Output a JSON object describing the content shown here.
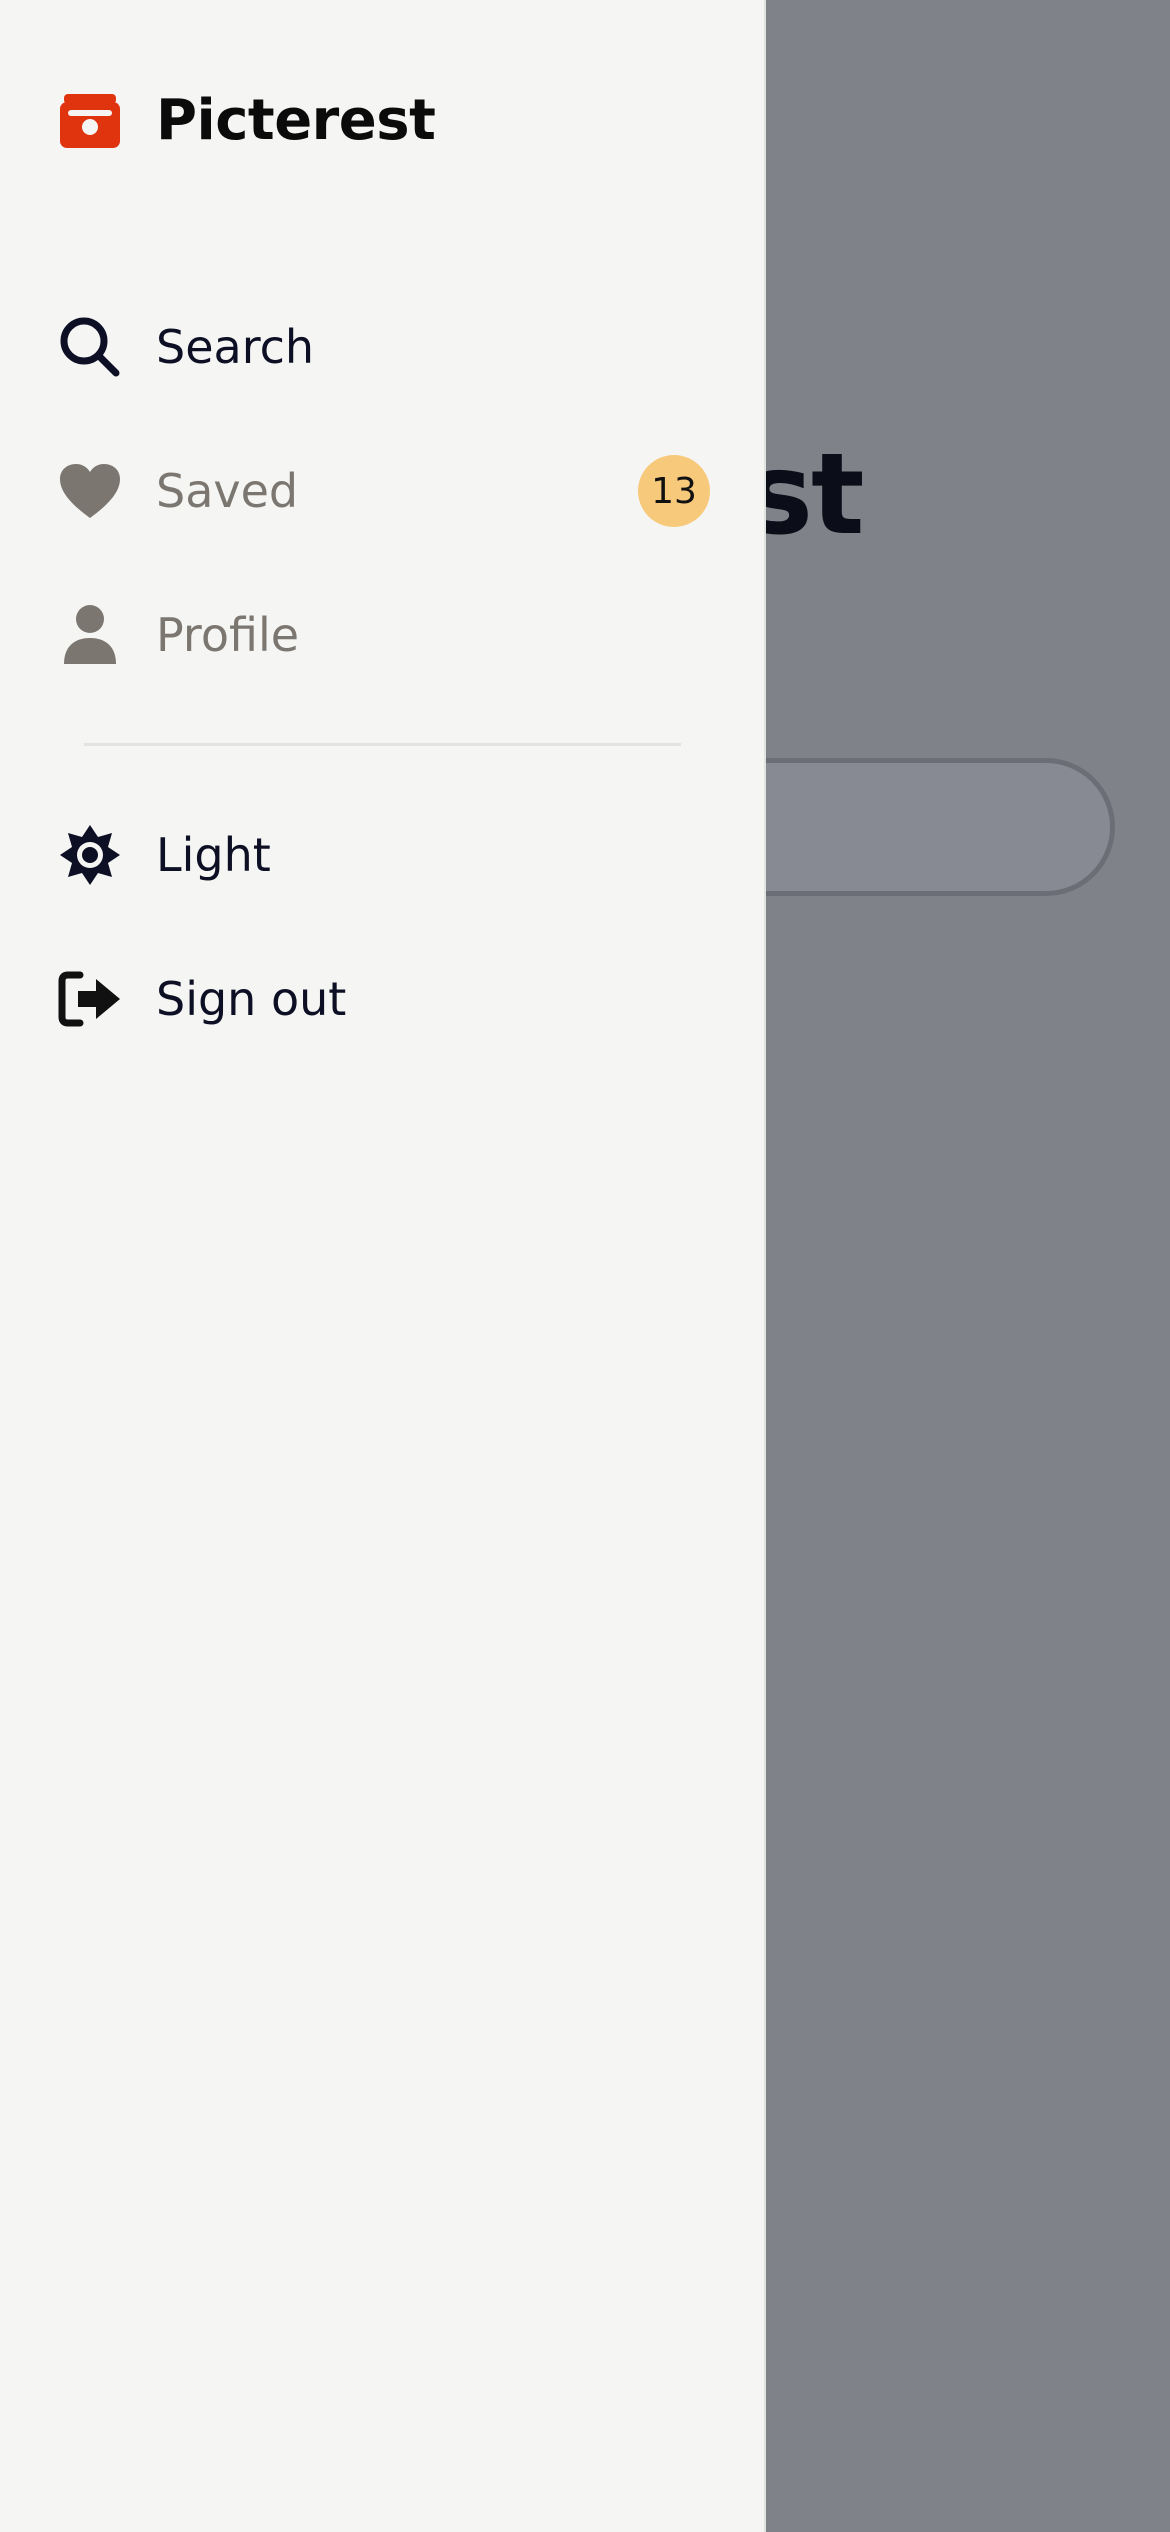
{
  "background": {
    "title_fragment": "est"
  },
  "drawer": {
    "brand": {
      "name": "Picterest",
      "icon": "camera-icon",
      "color": "#e0340f"
    },
    "nav": [
      {
        "label": "Search",
        "icon": "search-icon",
        "active": true
      },
      {
        "label": "Saved",
        "icon": "heart-icon",
        "active": false,
        "badge": "13"
      },
      {
        "label": "Profile",
        "icon": "person-icon",
        "active": false
      }
    ],
    "settings": [
      {
        "label": "Light",
        "icon": "sun-icon"
      },
      {
        "label": "Sign out",
        "icon": "sign-out-icon"
      }
    ]
  },
  "colors": {
    "accent": "#e0340f",
    "badge": "#f7c97a",
    "text_dark": "#0d0f24",
    "text_muted": "#7b7670",
    "drawer_bg": "#f5f5f3",
    "overlay": "#808289"
  }
}
